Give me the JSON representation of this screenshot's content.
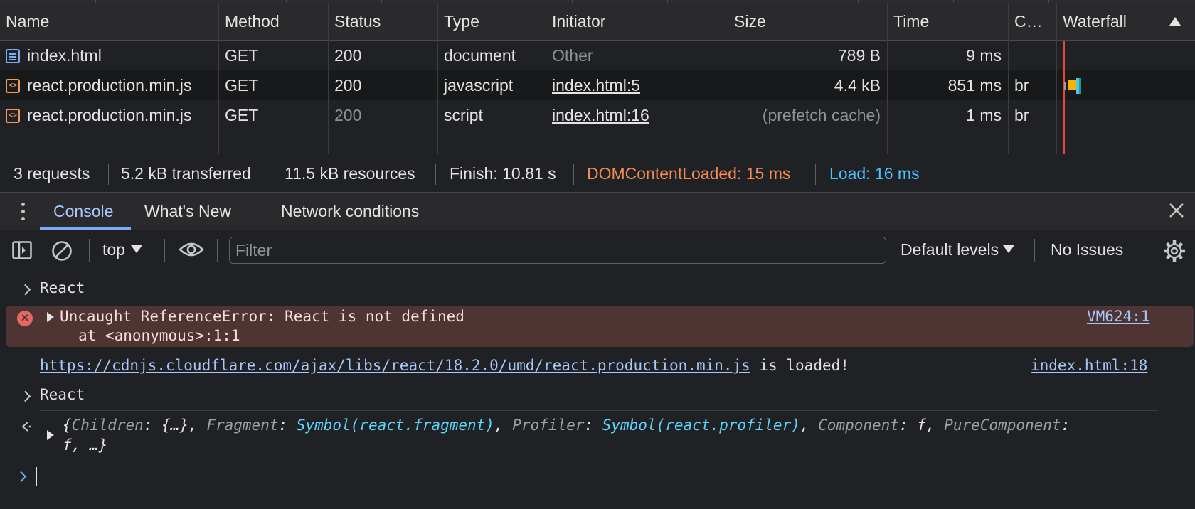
{
  "network": {
    "columns": [
      "Name",
      "Method",
      "Status",
      "Type",
      "Initiator",
      "Size",
      "Time",
      "C…",
      "Waterfall"
    ],
    "rows": [
      {
        "name": "index.html",
        "icon": "document-icon",
        "method": "GET",
        "status": "200",
        "type": "document",
        "initiator": "Other",
        "size": "789 B",
        "time": "9 ms",
        "c": ""
      },
      {
        "name": "react.production.min.js",
        "icon": "script-icon",
        "method": "GET",
        "status": "200",
        "type": "javascript",
        "initiator": "index.html:5",
        "size": "4.4 kB",
        "time": "851 ms",
        "c": "br"
      },
      {
        "name": "react.production.min.js",
        "icon": "script-icon",
        "method": "GET",
        "status": "200",
        "type": "script",
        "initiator": "index.html:16",
        "size": "(prefetch cache)",
        "time": "1 ms",
        "c": "br"
      }
    ],
    "summary": {
      "requests": "3 requests",
      "transferred": "5.2 kB transferred",
      "resources": "11.5 kB resources",
      "finish": "Finish: 10.81 s",
      "dcl": "DOMContentLoaded: 15 ms",
      "load": "Load: 16 ms"
    }
  },
  "drawer": {
    "tabs": [
      "Console",
      "What's New",
      "Network conditions"
    ],
    "active_tab": "Console"
  },
  "toolbar": {
    "context": "top",
    "filter_placeholder": "Filter",
    "levels": "Default levels",
    "issues": "No Issues"
  },
  "console": {
    "input1": "React",
    "error": {
      "message": "Uncaught ReferenceError: React is not defined",
      "stack": "at <anonymous>:1:1",
      "source": "VM624:1"
    },
    "log": {
      "url": "https://cdnjs.cloudflare.com/ajax/libs/react/18.2.0/umd/react.production.min.js",
      "text": " is loaded!",
      "source": "index.html:18"
    },
    "input2": "React",
    "result": {
      "k1": "Children",
      "v1": "{…}",
      "k2": "Fragment",
      "v2": "Symbol(react.fragment)",
      "k3": "Profiler",
      "v3": "Symbol(react.profiler)",
      "k4": "Component",
      "v4": "f",
      "k5": "PureComponent",
      "line2": "f, …}"
    }
  },
  "colors": {
    "background": "#202124",
    "dcl": "#f28b54",
    "load": "#4cc2ff",
    "error_bg": "#4e3534",
    "link": "#a8c7fa"
  }
}
